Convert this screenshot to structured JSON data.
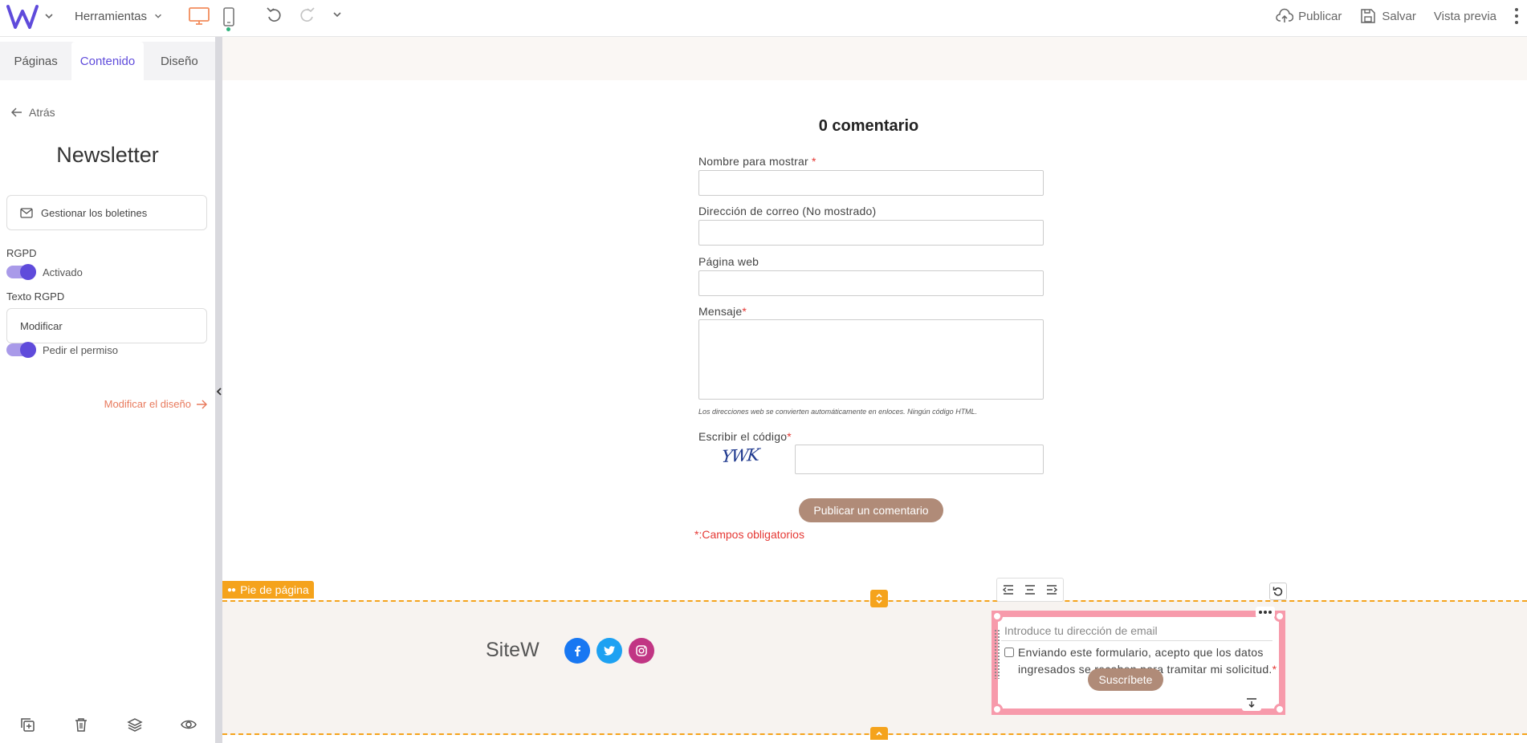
{
  "topbar": {
    "tools_label": "Herramientas",
    "publish_label": "Publicar",
    "save_label": "Salvar",
    "preview_label": "Vista previa"
  },
  "panel": {
    "tabs": [
      {
        "label": "Páginas"
      },
      {
        "label": "Contenido"
      },
      {
        "label": "Diseño"
      }
    ],
    "back_label": "Atrás",
    "title": "Newsletter",
    "manage_label": "Gestionar los boletines",
    "gdpr_label": "RGPD",
    "gdpr_toggle_label": "Activado",
    "gdpr_text_label": "Texto RGPD",
    "modify_label": "Modificar",
    "permission_label": "Pedir el permiso",
    "design_link_label": "Modificar el diseño"
  },
  "comments": {
    "title": "0 comentario",
    "name_label": "Nombre para mostrar",
    "email_label": "Dirección de correo (No mostrado)",
    "website_label": "Página web",
    "message_label": "Mensaje",
    "hint": "Los direcciones web se convierten automáticamente en enloces. Ningún código HTML.",
    "code_label": "Escribir el código",
    "captcha_text": "YWK",
    "submit_label": "Publicar un comentario",
    "required_note": "*:Campos obligatorios",
    "required_mark": "*"
  },
  "footer": {
    "tag_label": "Pie de página",
    "brand": "SiteW",
    "social": [
      {
        "name": "facebook",
        "color": "#1877f2"
      },
      {
        "name": "twitter",
        "color": "#1da1f2"
      },
      {
        "name": "instagram",
        "color": "#c13584"
      }
    ]
  },
  "newsletter": {
    "email_placeholder": "Introduce tu dirección de email",
    "consent_text": "Enviando este formulario, acepto que los datos ingresados se recaben para tramitar mi solicitud.",
    "required_mark": "*",
    "subscribe_label": "Suscríbete"
  },
  "colors": {
    "accent": "#5f4bdb",
    "footer_outline": "#f5a31c",
    "selection": "#f79aab",
    "button": "#b08b78",
    "required": "#e53935"
  }
}
